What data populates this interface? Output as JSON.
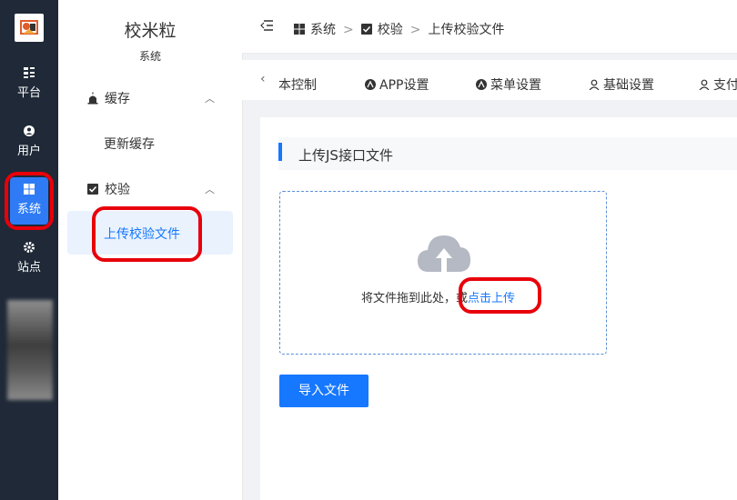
{
  "rail": {
    "items": [
      {
        "label": "平台",
        "icon": "platform-icon"
      },
      {
        "label": "用户",
        "icon": "user-icon"
      },
      {
        "label": "系统",
        "icon": "windows-icon"
      },
      {
        "label": "站点",
        "icon": "gear-icon"
      }
    ],
    "active_color": "#2f7bf5"
  },
  "submenu": {
    "title": "校米粒",
    "subtitle": "系统",
    "groups": [
      {
        "label": "缓存",
        "icon": "alarm-icon",
        "items": [
          "更新缓存"
        ]
      },
      {
        "label": "校验",
        "icon": "checkbox-icon",
        "items": [
          "上传校验文件"
        ]
      }
    ]
  },
  "breadcrumb": {
    "items": [
      "系统",
      "校验",
      "上传校验文件"
    ],
    "separator": ">"
  },
  "tabs": [
    "版本控制",
    "APP设置",
    "菜单设置",
    "基础设置",
    "支付"
  ],
  "visible_tab_fragments": [
    "本控制",
    "APP设置",
    "菜单设置",
    "基础设置",
    "支付"
  ],
  "main": {
    "section_title": "上传JS接口文件",
    "upload": {
      "text": "将文件拖到此处，或",
      "link": "点击上传"
    },
    "import_button": "导入文件"
  },
  "colors": {
    "accent": "#1677ff",
    "highlight": "#e8000b",
    "sidebar_bg": "#1f2937"
  }
}
